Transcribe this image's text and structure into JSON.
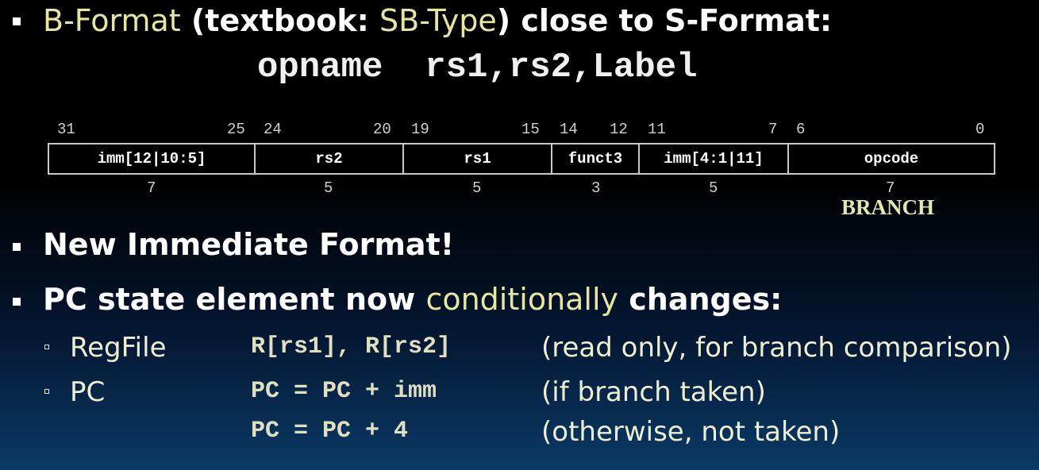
{
  "line1": {
    "part1": "B-Format",
    "part2": " (textbook: ",
    "part3": "SB-Type",
    "part4": ") close to S-Format:"
  },
  "syntax": "opname  rs1,rs2,Label",
  "instruction_format": {
    "bit_labels": [
      "31",
      "25",
      "24",
      "20",
      "19",
      "15",
      "14",
      "12",
      "11",
      "7",
      "6",
      "0"
    ],
    "fields": [
      {
        "name": "imm[12|10:5]",
        "width": "7"
      },
      {
        "name": "rs2",
        "width": "5"
      },
      {
        "name": "rs1",
        "width": "5"
      },
      {
        "name": "funct3",
        "width": "3"
      },
      {
        "name": "imm[4:1|11]",
        "width": "5"
      },
      {
        "name": "opcode",
        "width": "7"
      }
    ],
    "opcode_value": "BRANCH"
  },
  "bullet2": "New Immediate Format!",
  "bullet3": {
    "part1": "PC state element now ",
    "part2": "conditionally",
    "part3": " changes:"
  },
  "rows": [
    {
      "label": "RegFile",
      "code": "R[rs1], R[rs2]",
      "note": "(read only, for branch comparison)"
    },
    {
      "label": "PC",
      "code": "PC = PC + imm",
      "note": "(if branch taken)"
    },
    {
      "label": "",
      "code": "PC = PC + 4",
      "note": "(otherwise, not taken)"
    }
  ]
}
